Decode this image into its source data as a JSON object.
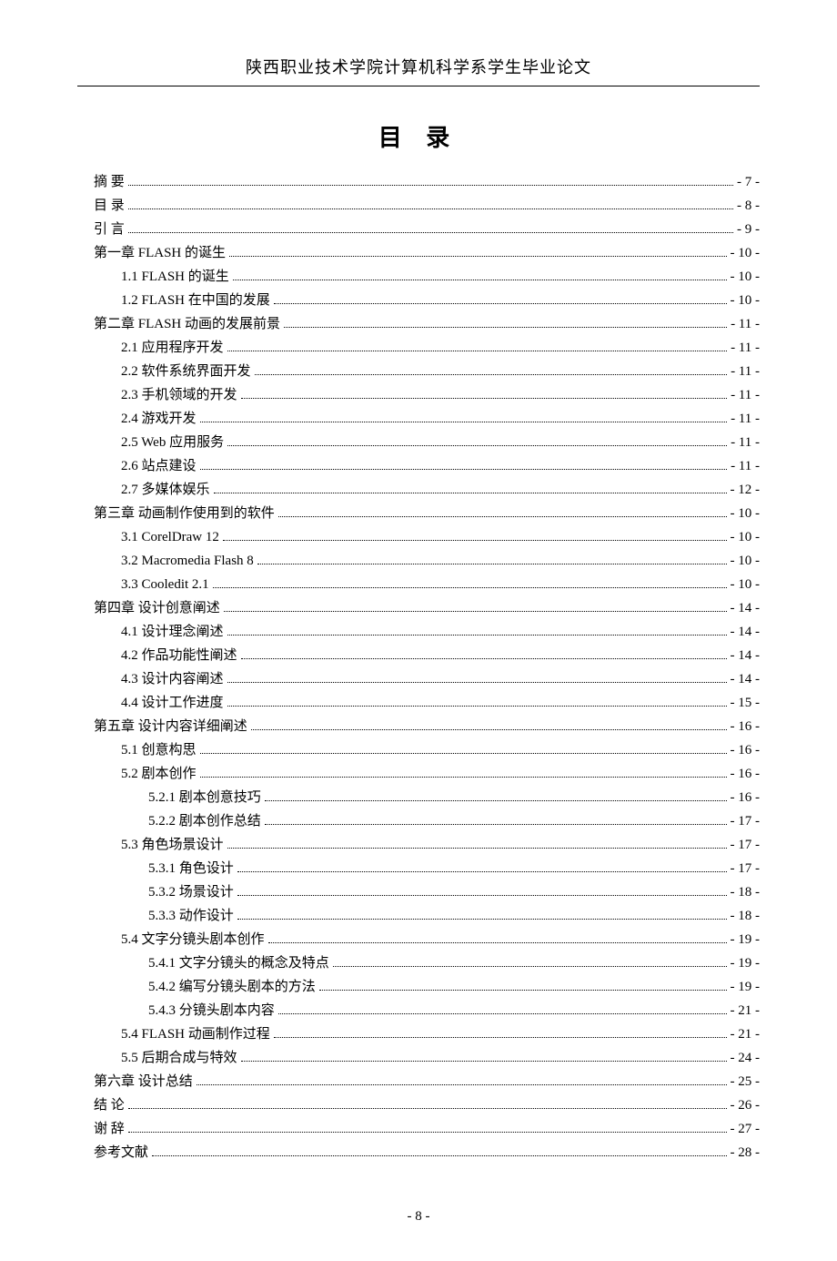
{
  "header": "陕西职业技术学院计算机科学系学生毕业论文",
  "toc_title": "目 录",
  "footer": "- 8 -",
  "toc": [
    {
      "level": 0,
      "label": "摘  要",
      "page": "- 7 -"
    },
    {
      "level": 0,
      "label": "目  录",
      "page": "- 8 -"
    },
    {
      "level": 0,
      "label": "引  言",
      "page": "- 9 -"
    },
    {
      "level": 0,
      "label": "第一章  FLASH 的诞生",
      "page": "- 10 -"
    },
    {
      "level": 1,
      "label": "1.1 FLASH 的诞生",
      "page": "- 10 -"
    },
    {
      "level": 1,
      "label": "1.2 FLASH 在中国的发展",
      "page": "- 10 -"
    },
    {
      "level": 0,
      "label": "第二章 FLASH 动画的发展前景",
      "page": "- 11 -"
    },
    {
      "level": 1,
      "label": "2.1 应用程序开发",
      "page": "- 11 -"
    },
    {
      "level": 1,
      "label": "2.2 软件系统界面开发",
      "page": "- 11 -"
    },
    {
      "level": 1,
      "label": "2.3 手机领域的开发",
      "page": "- 11 -"
    },
    {
      "level": 1,
      "label": "2.4 游戏开发",
      "page": "- 11 -"
    },
    {
      "level": 1,
      "label": "2.5 Web 应用服务",
      "page": "- 11 -"
    },
    {
      "level": 1,
      "label": "2.6 站点建设",
      "page": "- 11 -"
    },
    {
      "level": 1,
      "label": "2.7 多媒体娱乐",
      "page": "- 12 -"
    },
    {
      "level": 0,
      "label": "第三章  动画制作使用到的软件",
      "page": "- 10 -"
    },
    {
      "level": 1,
      "label": "3.1 CorelDraw 12",
      "page": "- 10 -"
    },
    {
      "level": 1,
      "label": "3.2 Macromedia Flash 8",
      "page": "- 10 -"
    },
    {
      "level": 1,
      "label": "3.3 Cooledit 2.1",
      "page": "- 10 -"
    },
    {
      "level": 0,
      "label": "第四章  设计创意阐述",
      "page": "- 14 -"
    },
    {
      "level": 1,
      "label": "4.1 设计理念阐述",
      "page": "- 14 -"
    },
    {
      "level": 1,
      "label": "4.2 作品功能性阐述",
      "page": "- 14 -"
    },
    {
      "level": 1,
      "label": "4.3 设计内容阐述",
      "page": "- 14 -"
    },
    {
      "level": 1,
      "label": "4.4 设计工作进度",
      "page": "- 15 -"
    },
    {
      "level": 0,
      "label": "第五章  设计内容详细阐述",
      "page": "- 16 -"
    },
    {
      "level": 1,
      "label": "5.1 创意构思",
      "page": "- 16 -"
    },
    {
      "level": 1,
      "label": "5.2 剧本创作",
      "page": "- 16 -"
    },
    {
      "level": 2,
      "label": "5.2.1 剧本创意技巧",
      "page": "- 16 -"
    },
    {
      "level": 2,
      "label": "5.2.2 剧本创作总结",
      "page": "- 17 -"
    },
    {
      "level": 1,
      "label": "5.3 角色场景设计",
      "page": "- 17 -"
    },
    {
      "level": 2,
      "label": "5.3.1 角色设计",
      "page": "- 17 -"
    },
    {
      "level": 2,
      "label": "5.3.2 场景设计",
      "page": "- 18 -"
    },
    {
      "level": 2,
      "label": "5.3.3 动作设计",
      "page": "- 18 -"
    },
    {
      "level": 1,
      "label": "5.4 文字分镜头剧本创作",
      "page": "- 19 -"
    },
    {
      "level": 2,
      "label": "5.4.1 文字分镜头的概念及特点",
      "page": "- 19 -"
    },
    {
      "level": 2,
      "label": "5.4.2 编写分镜头剧本的方法",
      "page": "- 19 -"
    },
    {
      "level": 2,
      "label": "5.4.3 分镜头剧本内容",
      "page": "- 21 -"
    },
    {
      "level": 1,
      "label": "5.4 FLASH 动画制作过程",
      "page": "- 21 -"
    },
    {
      "level": 1,
      "label": "5.5 后期合成与特效",
      "page": "- 24 -"
    },
    {
      "level": 0,
      "label": "第六章  设计总结",
      "page": "- 25 -"
    },
    {
      "level": 0,
      "label": "结  论",
      "page": "- 26 -"
    },
    {
      "level": 0,
      "label": "谢  辞",
      "page": "- 27 -"
    },
    {
      "level": 0,
      "label": "参考文献",
      "page": "- 28 -"
    }
  ]
}
